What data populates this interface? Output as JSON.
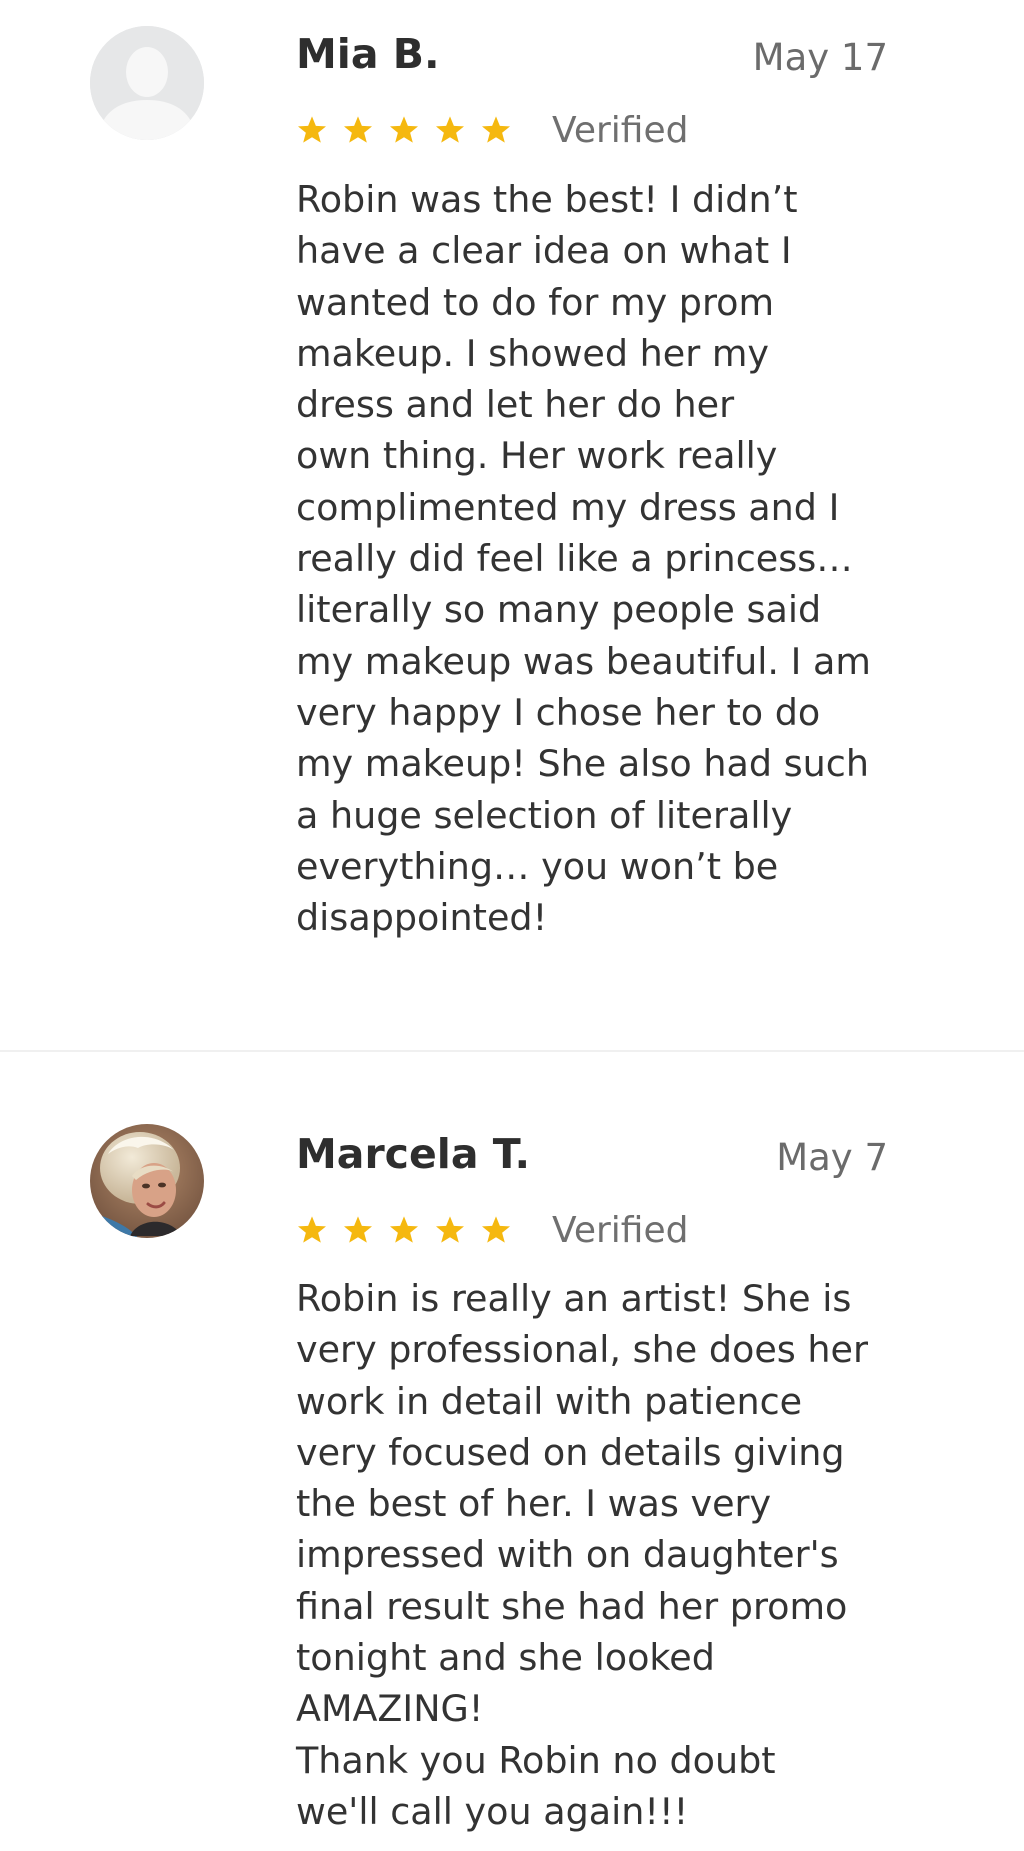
{
  "reviews": [
    {
      "reviewer_name": "Mia B.",
      "date": "May 17",
      "rating": 5,
      "verified_label": "Verified",
      "avatar": "default-person-avatar",
      "body_lines": [
        "Robin was the best! I didn’t",
        "have a clear idea on what I",
        "wanted to do for my prom",
        "makeup. I showed her my",
        "dress and let her do her",
        "own thing. Her work really",
        "complimented my dress and I",
        "really did feel like a princess…",
        "literally so many people said",
        "my makeup was beautiful. I am",
        "very happy I chose her to do",
        "my makeup! She also had such",
        "a huge selection of literally",
        "everything… you won’t be",
        "disappointed!"
      ]
    },
    {
      "reviewer_name": "Marcela T.",
      "date": "May 7",
      "rating": 5,
      "verified_label": "Verified",
      "avatar": "user-photo-avatar",
      "body_lines": [
        "Robin is really an artist! She is",
        "very professional, she does her",
        "work in detail with patience",
        "very focused on details giving",
        "the best of her. I was very",
        "impressed with on daughter's",
        "final result she had her promo",
        "tonight and she looked",
        "AMAZING!",
        "Thank you Robin no doubt",
        "we'll call you again!!!"
      ]
    }
  ],
  "colors": {
    "star": "#f5b80f",
    "name": "#2e2e2e",
    "meta": "#6b6b6b",
    "body": "#333333",
    "divider": "#f0f0f0",
    "avatar_placeholder_bg": "#e6e7e8",
    "avatar_placeholder_fg": "#f7f7f7"
  }
}
